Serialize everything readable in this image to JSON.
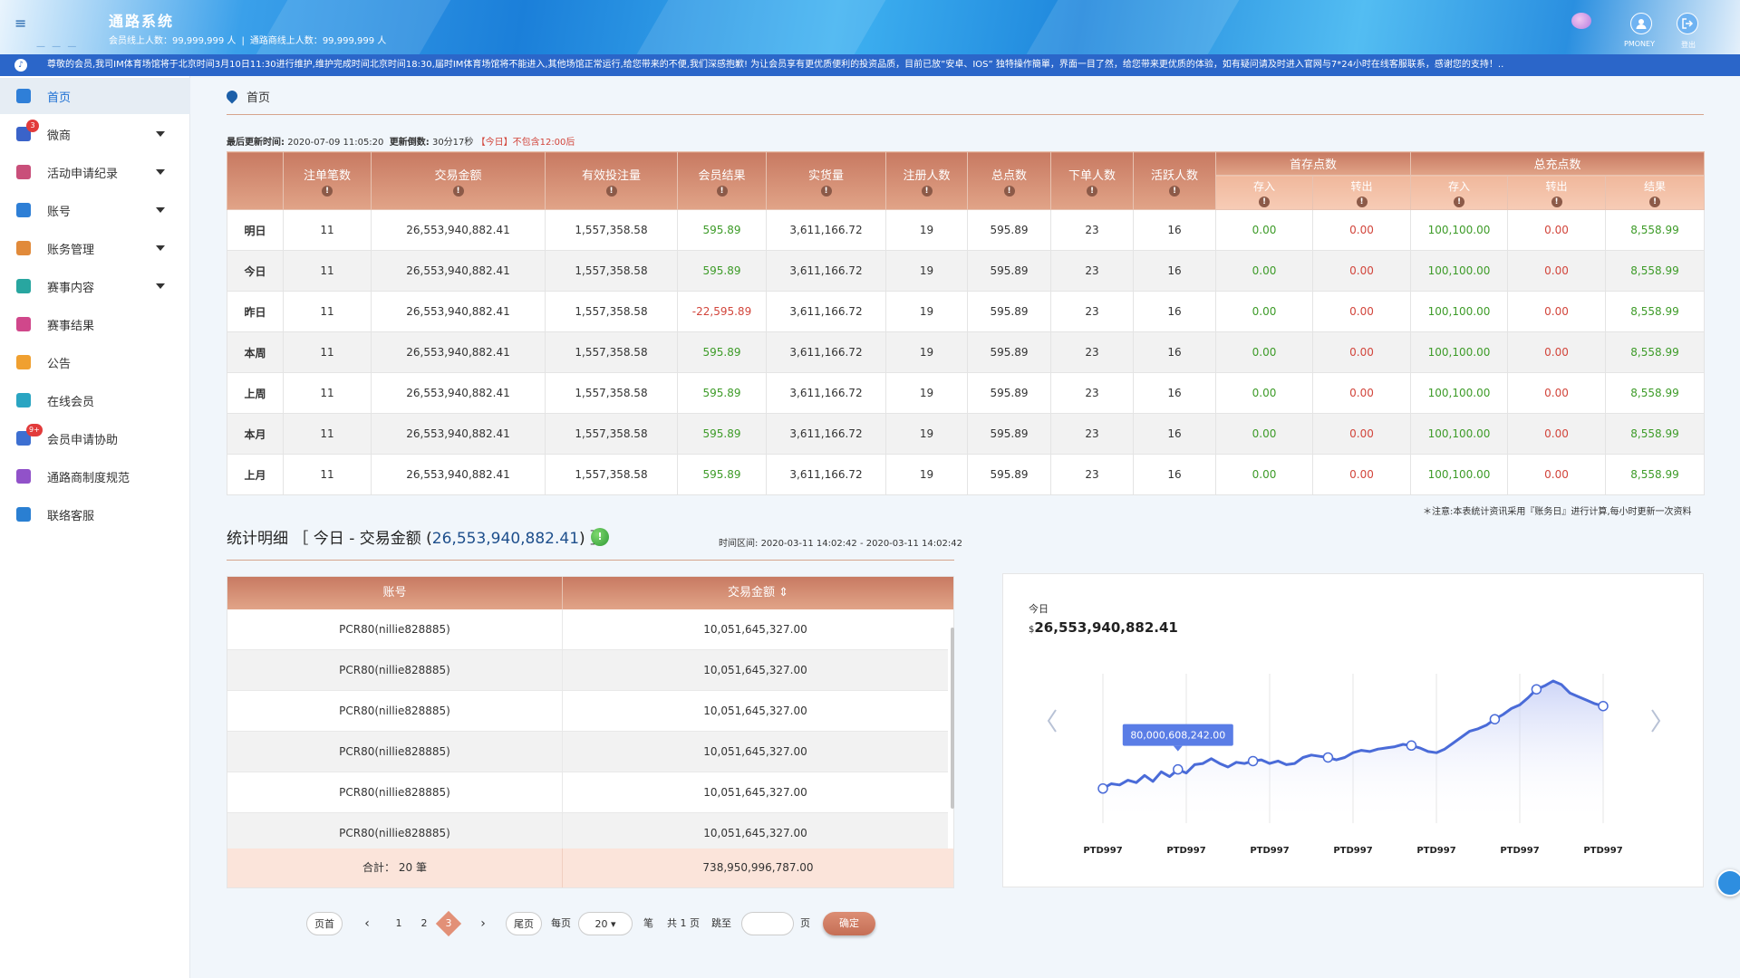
{
  "header": {
    "title": "通路系统",
    "member_online_label": "会员线上人数：",
    "member_online_count": "99,999,999 人",
    "channel_online_label": "通路商线上人数：",
    "channel_online_count": "99,999,999 人",
    "user_label": "PMONEY",
    "logout_label": "登出"
  },
  "marquee": {
    "text": "尊敬的会员,我司IM体育场馆将于北京时间3月10日11:30进行维护,维护完成时间北京时间18:30,届时IM体育场馆将不能进入,其他场馆正常运行,给您带来的不便,我们深感抱歉! 为让会员享有更优质便利的投资品质，目前已放”安卓、IOS” 独特操作簡單，界面一目了然，给您带来更优质的体验，如有疑问请及时进入官网与7*24小时在线客服联系，感谢您的支持！.."
  },
  "sidebar": {
    "items": [
      {
        "label": "首页",
        "icon": "home-icon",
        "color": "#2f7fd8",
        "active": true,
        "caret": false,
        "badge": ""
      },
      {
        "label": "微商",
        "icon": "wechat-shop-icon",
        "color": "#3a63c9",
        "active": false,
        "caret": true,
        "badge": "3"
      },
      {
        "label": "活动申请纪录",
        "icon": "activity-record-icon",
        "color": "#c94f7a",
        "active": false,
        "caret": true,
        "badge": ""
      },
      {
        "label": "账号",
        "icon": "account-icon",
        "color": "#2e7fd6",
        "active": false,
        "caret": true,
        "badge": ""
      },
      {
        "label": "账务管理",
        "icon": "finance-icon",
        "color": "#e18a3a",
        "active": false,
        "caret": true,
        "badge": ""
      },
      {
        "label": "赛事内容",
        "icon": "event-content-icon",
        "color": "#28a6a0",
        "active": false,
        "caret": true,
        "badge": ""
      },
      {
        "label": "赛事结果",
        "icon": "event-result-icon",
        "color": "#d0478b",
        "active": false,
        "caret": false,
        "badge": ""
      },
      {
        "label": "公告",
        "icon": "announcement-icon",
        "color": "#f0a030",
        "active": false,
        "caret": false,
        "badge": ""
      },
      {
        "label": "在线会员",
        "icon": "online-member-icon",
        "color": "#2aa5c2",
        "active": false,
        "caret": false,
        "badge": ""
      },
      {
        "label": "会员申请协助",
        "icon": "member-assist-icon",
        "color": "#3d6fd1",
        "active": false,
        "caret": false,
        "badge": "9+"
      },
      {
        "label": "通路商制度规范",
        "icon": "channel-policy-icon",
        "color": "#9152c9",
        "active": false,
        "caret": false,
        "badge": ""
      },
      {
        "label": "联络客服",
        "icon": "customer-service-icon",
        "color": "#2a7fd2",
        "active": false,
        "caret": false,
        "badge": ""
      }
    ]
  },
  "breadcrumb": {
    "label": "首页"
  },
  "update": {
    "last_label": "最后更新时间:",
    "last_value": "2020-07-09 11:05:20",
    "countdown_label": "更新倒数:",
    "countdown_value": "30分17秒",
    "today_note": "【今日】不包含12:00后"
  },
  "summary": {
    "headers": [
      "注单笔数",
      "交易金额",
      "有效投注量",
      "会员结果",
      "实货量",
      "注册人数",
      "总点数",
      "下单人数",
      "活跃人数"
    ],
    "group1": "首存点数",
    "group2": "总充点数",
    "sub_headers": [
      "存入",
      "转出",
      "存入",
      "转出",
      "结果"
    ],
    "rows": [
      {
        "label": "明日",
        "cells": [
          "11",
          "26,553,940,882.41",
          "1,557,358.58",
          "595.89",
          "3,611,166.72",
          "19",
          "595.89",
          "23",
          "16",
          "0.00",
          "0.00",
          "100,100.00",
          "0.00",
          "8,558.99"
        ],
        "negative": false
      },
      {
        "label": "今日",
        "cells": [
          "11",
          "26,553,940,882.41",
          "1,557,358.58",
          "595.89",
          "3,611,166.72",
          "19",
          "595.89",
          "23",
          "16",
          "0.00",
          "0.00",
          "100,100.00",
          "0.00",
          "8,558.99"
        ],
        "negative": false
      },
      {
        "label": "昨日",
        "cells": [
          "11",
          "26,553,940,882.41",
          "1,557,358.58",
          "-22,595.89",
          "3,611,166.72",
          "19",
          "595.89",
          "23",
          "16",
          "0.00",
          "0.00",
          "100,100.00",
          "0.00",
          "8,558.99"
        ],
        "negative": true
      },
      {
        "label": "本周",
        "cells": [
          "11",
          "26,553,940,882.41",
          "1,557,358.58",
          "595.89",
          "3,611,166.72",
          "19",
          "595.89",
          "23",
          "16",
          "0.00",
          "0.00",
          "100,100.00",
          "0.00",
          "8,558.99"
        ],
        "negative": false
      },
      {
        "label": "上周",
        "cells": [
          "11",
          "26,553,940,882.41",
          "1,557,358.58",
          "595.89",
          "3,611,166.72",
          "19",
          "595.89",
          "23",
          "16",
          "0.00",
          "0.00",
          "100,100.00",
          "0.00",
          "8,558.99"
        ],
        "negative": false
      },
      {
        "label": "本月",
        "cells": [
          "11",
          "26,553,940,882.41",
          "1,557,358.58",
          "595.89",
          "3,611,166.72",
          "19",
          "595.89",
          "23",
          "16",
          "0.00",
          "0.00",
          "100,100.00",
          "0.00",
          "8,558.99"
        ],
        "negative": false
      },
      {
        "label": "上月",
        "cells": [
          "11",
          "26,553,940,882.41",
          "1,557,358.58",
          "595.89",
          "3,611,166.72",
          "19",
          "595.89",
          "23",
          "16",
          "0.00",
          "0.00",
          "100,100.00",
          "0.00",
          "8,558.99"
        ],
        "negative": false
      }
    ],
    "note": "＊注意:本表统计资讯采用『账务日』进行计算,每小时更新一次资料"
  },
  "detail": {
    "title_prefix": "统计明细 ［ 今日 - 交易金额 (",
    "title_amount": "26,553,940,882.41",
    "title_suffix": ") ］",
    "range_label": "时间区间:",
    "range_value": "2020-03-11 14:02:42 - 2020-03-11 14:02:42",
    "col_account": "账号",
    "col_amount": "交易金额",
    "rows": [
      {
        "account": "PCR80(nillie828885)",
        "amount": "10,051,645,327.00"
      },
      {
        "account": "PCR80(nillie828885)",
        "amount": "10,051,645,327.00"
      },
      {
        "account": "PCR80(nillie828885)",
        "amount": "10,051,645,327.00"
      },
      {
        "account": "PCR80(nillie828885)",
        "amount": "10,051,645,327.00"
      },
      {
        "account": "PCR80(nillie828885)",
        "amount": "10,051,645,327.00"
      },
      {
        "account": "PCR80(nillie828885)",
        "amount": "10,051,645,327.00"
      }
    ],
    "total_label": "合計：  20 筆",
    "total_value": "738,950,996,787.00"
  },
  "pager": {
    "first": "页首",
    "last": "尾页",
    "pages": [
      "1",
      "2"
    ],
    "current": "3",
    "per_page_label": "每页",
    "per_page_value": "20",
    "count_unit": "笔",
    "total_pages": "共 1 页",
    "jump_label": "跳至",
    "page_unit": "页",
    "confirm": "确定",
    "prev_icon": "chevron-left-icon",
    "next_icon": "chevron-right-icon"
  },
  "chart_card": {
    "period": "今日",
    "currency": "$",
    "amount": "26,553,940,882.41",
    "tooltip": "80,000,608,242.00"
  },
  "chart_data": {
    "type": "area",
    "title": "",
    "xlabel": "",
    "ylabel": "",
    "x_ticks": [
      "PTD997",
      "PTD997",
      "PTD997",
      "PTD997",
      "PTD997",
      "PTD997",
      "PTD997"
    ],
    "series": [
      {
        "values": [
          0.1,
          0.14,
          0.13,
          0.17,
          0.15,
          0.21,
          0.16,
          0.24,
          0.2,
          0.26,
          0.23,
          0.3,
          0.31,
          0.35,
          0.31,
          0.28,
          0.32,
          0.31,
          0.33,
          0.34,
          0.31,
          0.33,
          0.3,
          0.31,
          0.36,
          0.38,
          0.37,
          0.36,
          0.34,
          0.36,
          0.4,
          0.42,
          0.41,
          0.43,
          0.44,
          0.45,
          0.47,
          0.46,
          0.44,
          0.41,
          0.4,
          0.43,
          0.48,
          0.53,
          0.58,
          0.6,
          0.63,
          0.68,
          0.72,
          0.77,
          0.8,
          0.86,
          0.93,
          0.96,
          1.0,
          0.97,
          0.9,
          0.87,
          0.84,
          0.81,
          0.79
        ]
      }
    ],
    "marker_indices": [
      0,
      9,
      18,
      27,
      37,
      47,
      52,
      60
    ],
    "tooltip_index": 9,
    "color": "#4a6bd8",
    "grid": false,
    "legend": "none"
  }
}
